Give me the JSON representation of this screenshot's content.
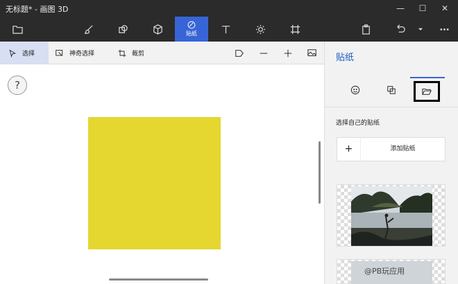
{
  "window": {
    "title": "无标题* - 画图 3D",
    "minimize": "—",
    "maximize": "☐",
    "close": "✕"
  },
  "toolbar": {
    "items": [
      {
        "name": "菜单"
      },
      {
        "name": "画笔"
      },
      {
        "name": "二维形状"
      },
      {
        "name": "三维形状"
      },
      {
        "name": "贴纸",
        "label": "贴纸",
        "active": true
      },
      {
        "name": "文本"
      },
      {
        "name": "效果"
      },
      {
        "name": "画布"
      }
    ],
    "right": [
      "粘贴",
      "撤消",
      "更多"
    ]
  },
  "subbar": {
    "select_label": "选择",
    "magic_select_label": "神奇选择",
    "crop_label": "裁剪"
  },
  "canvas": {
    "help_label": "?",
    "shape_color": "#e5d730"
  },
  "panel": {
    "title": "贴纸",
    "tabs": [
      "贴纸",
      "表面",
      "自定义贴纸"
    ],
    "section_label": "选择自己的贴纸",
    "add_plus": "+",
    "add_label": "添加贴纸"
  },
  "watermark": "@PB玩应用",
  "colors": {
    "accent": "#3765d7",
    "titlebar": "#2b2b2b",
    "panel_bg": "#f2f2f2"
  }
}
